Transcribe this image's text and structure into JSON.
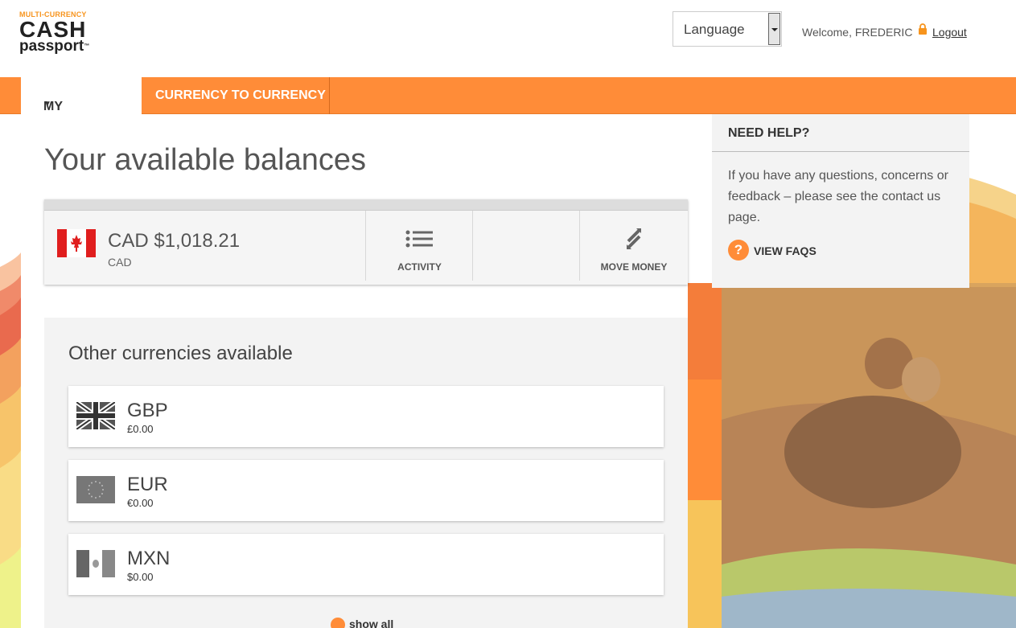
{
  "header": {
    "logo_top": "MULTI-CURRENCY",
    "logo_main": "CASH",
    "logo_sub": "passport",
    "language_label": "Language",
    "welcome_text": "Welcome, FREDERIC",
    "logout_label": "Logout"
  },
  "nav": {
    "my_account": "MY ACCOUNT",
    "currency_to_currency": "CURRENCY TO CURRENCY"
  },
  "main": {
    "title": "Your available balances",
    "primary": {
      "amount": "CAD $1,018.21",
      "code": "CAD",
      "activity_label": "ACTIVITY",
      "move_money_label": "MOVE MONEY"
    },
    "other_title": "Other currencies available",
    "currencies": [
      {
        "code": "GBP",
        "balance": "£0.00"
      },
      {
        "code": "EUR",
        "balance": "€0.00"
      },
      {
        "code": "MXN",
        "balance": "$0.00"
      }
    ],
    "show_all_label": "show all"
  },
  "help": {
    "title": "NEED HELP?",
    "text": "If you have any questions, concerns or feedback – please see the contact us page.",
    "faq_label": "VIEW FAQS"
  },
  "colors": {
    "accent": "#ff8c38",
    "panel": "#f3f3f3"
  }
}
